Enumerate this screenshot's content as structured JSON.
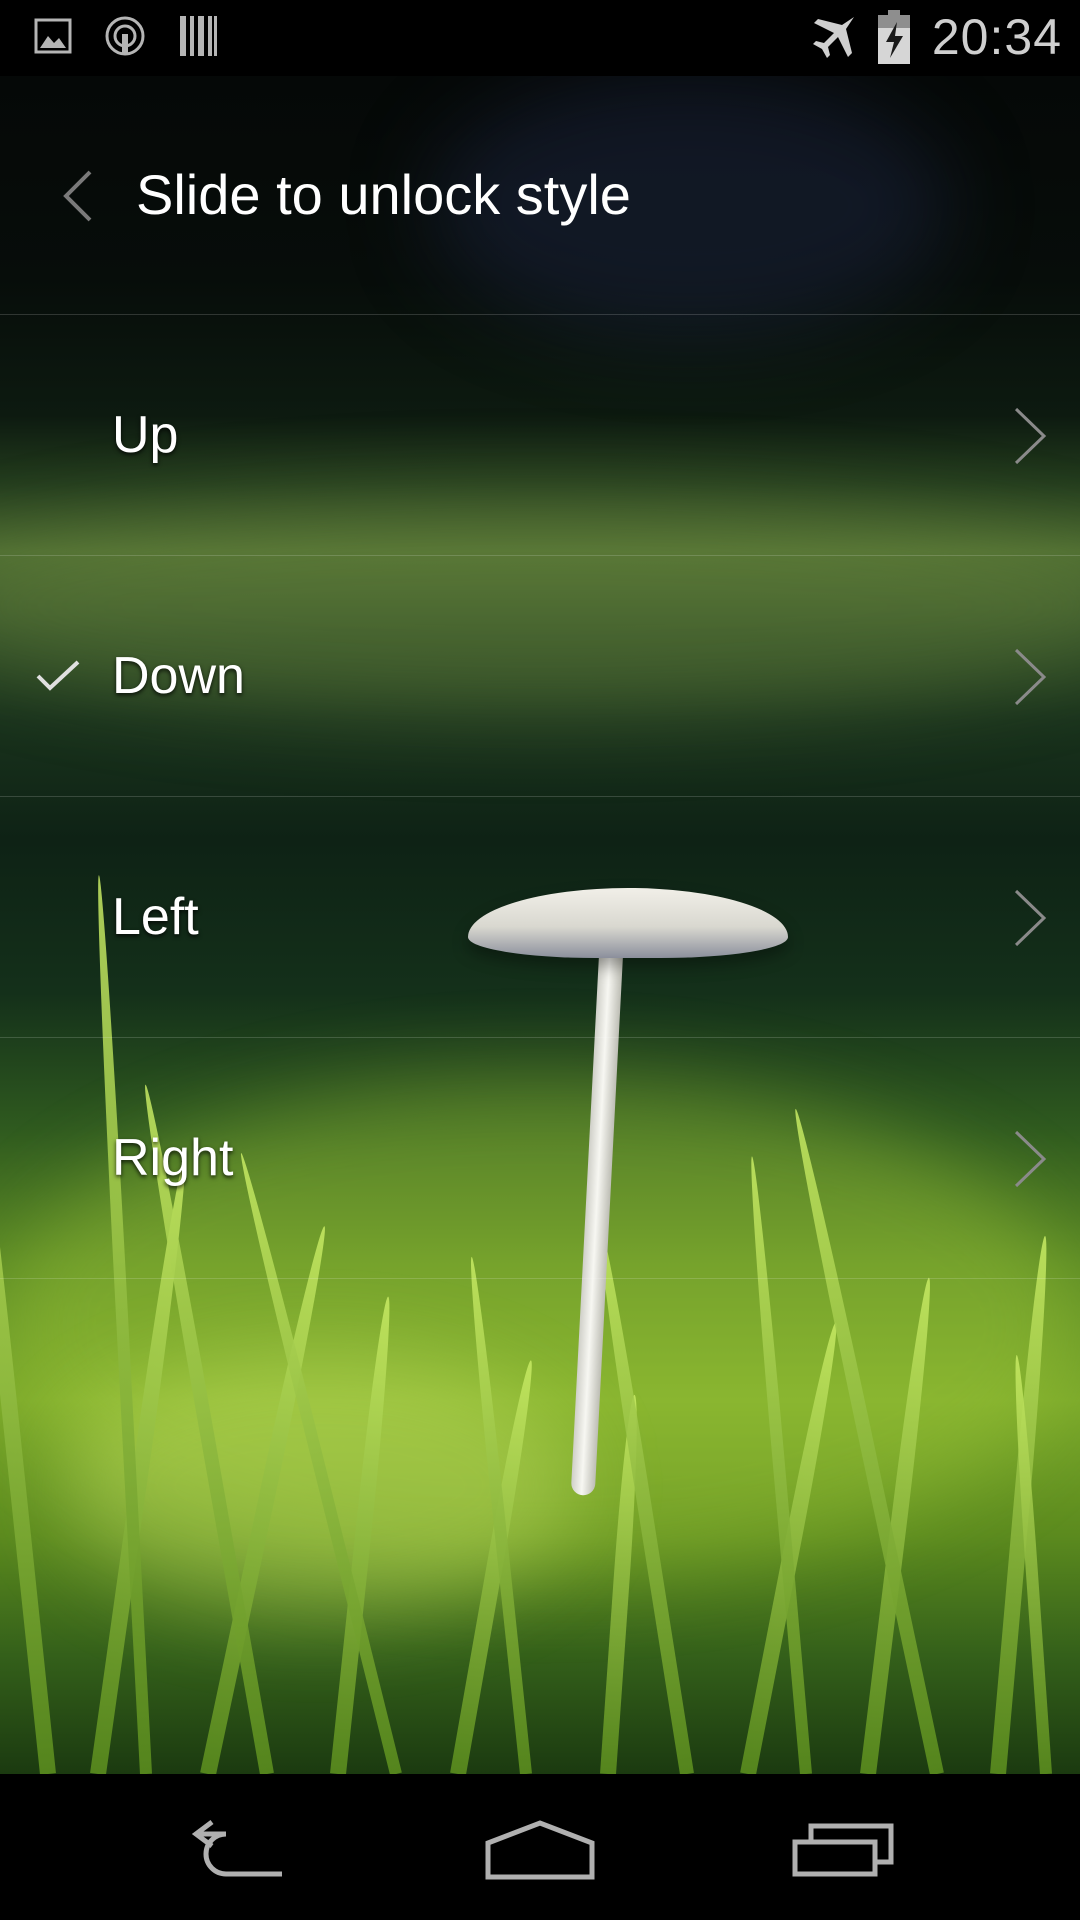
{
  "status_bar": {
    "time": "20:34",
    "left_icons": [
      "gallery-icon",
      "hotspot-icon",
      "barcode-icon"
    ],
    "right_icons": [
      "airplane-mode-icon",
      "battery-charging-icon"
    ]
  },
  "action_bar": {
    "title": "Slide to unlock style"
  },
  "options": [
    {
      "label": "Up",
      "checked": false
    },
    {
      "label": "Down",
      "checked": true
    },
    {
      "label": "Left",
      "checked": false
    },
    {
      "label": "Right",
      "checked": false
    }
  ],
  "nav_bar": {
    "buttons": [
      "back-icon",
      "home-icon",
      "recents-icon"
    ]
  },
  "colors": {
    "text": "#ffffff",
    "icon_gray": "#9e9e9e",
    "divider": "#ffffff29"
  }
}
